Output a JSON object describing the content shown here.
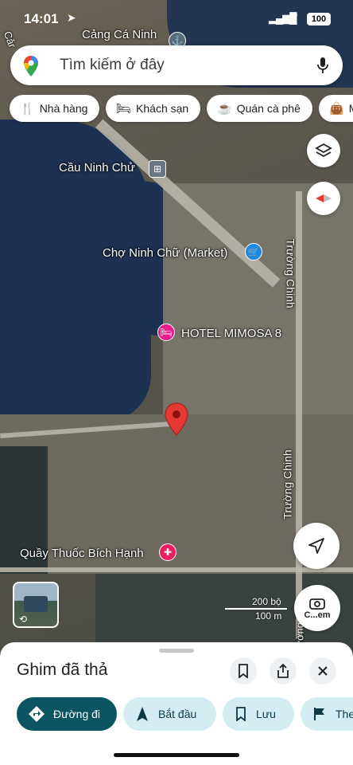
{
  "status_bar": {
    "time": "14:01",
    "battery": "100"
  },
  "search": {
    "placeholder": "Tìm kiếm ở đây"
  },
  "chips": [
    {
      "label": "Nhà hàng",
      "icon": "restaurant-icon"
    },
    {
      "label": "Khách sạn",
      "icon": "hotel-icon"
    },
    {
      "label": "Quán cà phê",
      "icon": "cafe-icon"
    },
    {
      "label": "M",
      "icon": "shopping-bag-icon"
    }
  ],
  "map_labels": {
    "top_port": "Cảng Cá Ninh",
    "top_left": "Cảr",
    "bridge": "Cầu Ninh Chử",
    "market": "Chợ Ninh Chữ (Market)",
    "hotel": "HOTEL MIMOSA 8",
    "pharmacy": "Quầy Thuốc Bích Hạnh",
    "street_1": "Trường Chinh",
    "street_2": "Trường Chinh",
    "street_3": "Trường Chin"
  },
  "scale": {
    "feet": "200 bộ",
    "meters": "100 m"
  },
  "camera_button": {
    "label": "C...em"
  },
  "sheet": {
    "title": "Ghim đã thả",
    "actions": [
      {
        "label": "Đường đi",
        "style": "primary"
      },
      {
        "label": "Bắt đầu",
        "style": "secondary"
      },
      {
        "label": "Lưu",
        "style": "secondary"
      },
      {
        "label": "The",
        "style": "secondary"
      }
    ]
  },
  "colors": {
    "primary": "#0b5563",
    "secondary_bg": "#d3edf3",
    "pin": "#e53935"
  }
}
